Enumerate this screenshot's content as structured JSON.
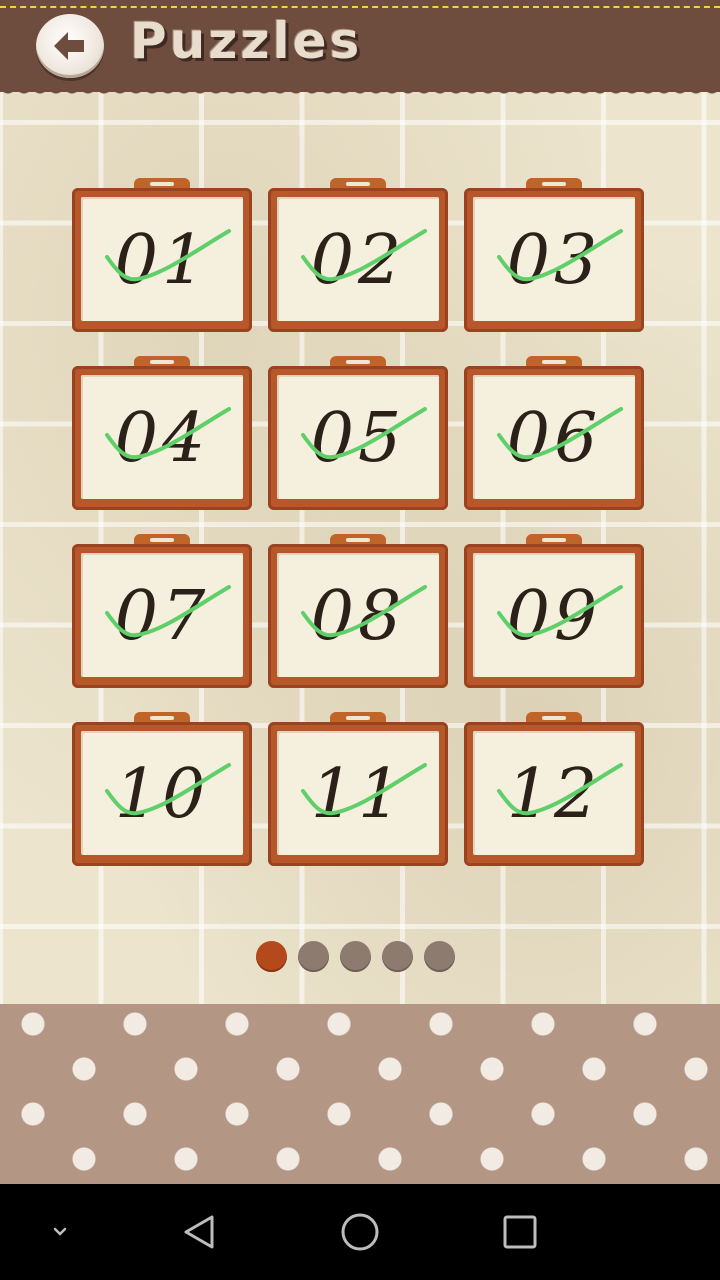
{
  "header": {
    "title": "Puzzles",
    "back_icon": "back-arrow-icon"
  },
  "levels": [
    {
      "label": "01",
      "completed": true
    },
    {
      "label": "02",
      "completed": true
    },
    {
      "label": "03",
      "completed": true
    },
    {
      "label": "04",
      "completed": true
    },
    {
      "label": "05",
      "completed": true
    },
    {
      "label": "06",
      "completed": true
    },
    {
      "label": "07",
      "completed": true
    },
    {
      "label": "08",
      "completed": true
    },
    {
      "label": "09",
      "completed": true
    },
    {
      "label": "10",
      "completed": true
    },
    {
      "label": "11",
      "completed": true
    },
    {
      "label": "12",
      "completed": true
    }
  ],
  "pager": {
    "page_count": 5,
    "current_page": 1
  },
  "colors": {
    "header_bg": "#6e4d3e",
    "tile_frame": "#b8582a",
    "check_green": "#5fcf6a",
    "dot_active": "#b4491b",
    "dot_inactive": "#8d7b70"
  },
  "system_nav": {
    "icons": [
      "chevron-down-icon",
      "back-triangle-icon",
      "home-circle-icon",
      "recents-square-icon"
    ]
  }
}
